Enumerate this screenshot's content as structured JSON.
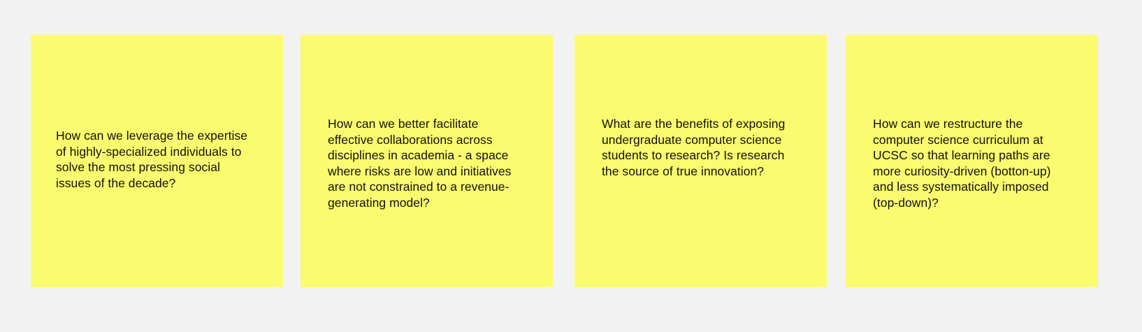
{
  "board": {
    "background_color": "#f2f2f2",
    "note_color": "#fbfb6f",
    "notes": [
      {
        "text": "How can we leverage the expertise of highly-specialized individuals to solve the most pressing social issues of the decade?"
      },
      {
        "text": "How can we better facilitate effective collaborations across disciplines in academia - a space where risks are low and initiatives are not constrained to a revenue-generating model?"
      },
      {
        "text": "What are the benefits of exposing undergraduate computer science students to research? Is research the source of true innovation?"
      },
      {
        "text": "How can we restructure the computer science curriculum at UCSC so that learning paths are more curiosity-driven (botton-up) and less systematically imposed (top-down)?"
      }
    ]
  }
}
